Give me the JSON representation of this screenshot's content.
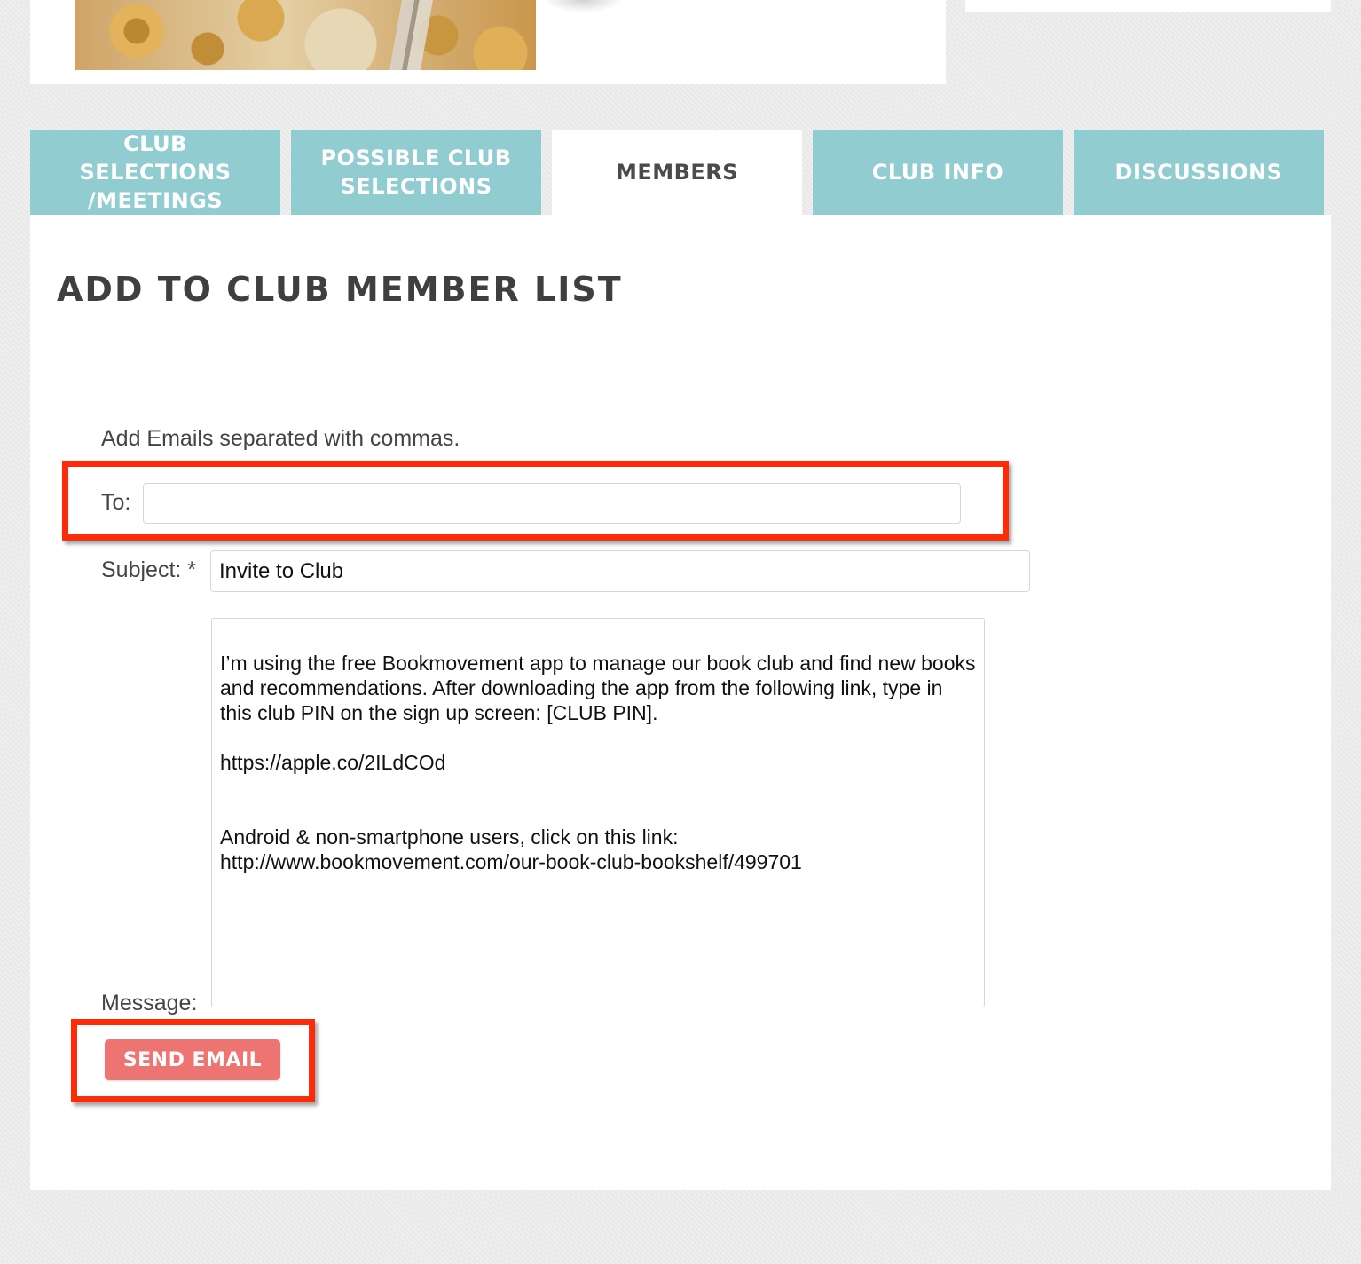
{
  "tabs": [
    {
      "label": "CLUB SELECTIONS /MEETINGS",
      "active": false
    },
    {
      "label": "POSSIBLE CLUB SELECTIONS",
      "active": false
    },
    {
      "label": "MEMBERS",
      "active": true
    },
    {
      "label": "CLUB INFO",
      "active": false
    },
    {
      "label": "DISCUSSIONS",
      "active": false
    }
  ],
  "page": {
    "title": "ADD TO CLUB MEMBER LIST"
  },
  "form": {
    "hint": "Add Emails separated with commas.",
    "to_label": "To:",
    "to_value": "",
    "subject_label": "Subject: *",
    "subject_value": "Invite to Club",
    "message_label": "Message:",
    "message_value": "I’m using the free Bookmovement app to manage our book club and find new books and recommendations. After downloading the app from the following link, type in this club PIN on the sign up screen: [CLUB PIN].\n\nhttps://apple.co/2ILdCOd\n\n\nAndroid & non-smartphone users, click on this link:\nhttp://www.bookmovement.com/our-book-club-bookshelf/499701",
    "send_label": "SEND EMAIL"
  },
  "colors": {
    "tab_bg": "#91cdd0",
    "tab_active_bg": "#ffffff",
    "send_button": "#ed7470",
    "annotation": "#fa2c0a"
  }
}
